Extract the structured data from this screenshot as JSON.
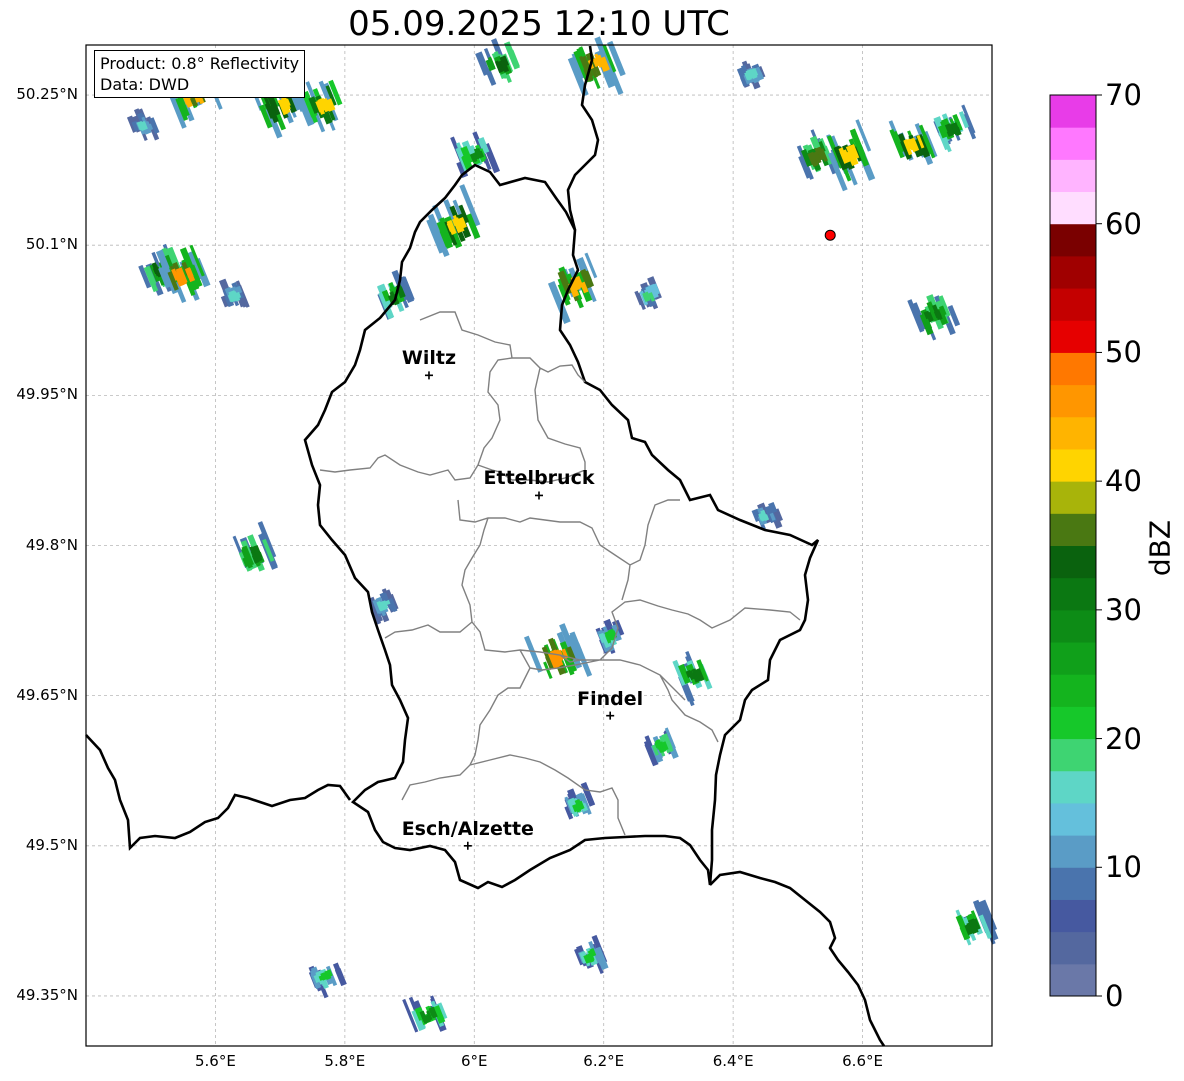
{
  "title": "05.09.2025 12:10 UTC",
  "info_box": {
    "product": "Product: 0.8° Reflectivity",
    "data": "Data: DWD"
  },
  "axes": {
    "lat_ticks": [
      "50.25°N",
      "50.1°N",
      "49.95°N",
      "49.8°N",
      "49.65°N",
      "49.5°N",
      "49.35°N"
    ],
    "lon_ticks": [
      "5.6°E",
      "5.8°E",
      "6°E",
      "6.2°E",
      "6.4°E",
      "6.6°E"
    ],
    "grid": true
  },
  "cities": [
    {
      "name": "Wiltz",
      "lon": 5.93,
      "lat": 49.97
    },
    {
      "name": "Ettelbruck",
      "lon": 6.1,
      "lat": 49.85
    },
    {
      "name": "Findel",
      "lon": 6.21,
      "lat": 49.63
    },
    {
      "name": "Esch/Alzette",
      "lon": 5.99,
      "lat": 49.5
    }
  ],
  "radar_site": {
    "lon": 6.55,
    "lat": 50.11,
    "color": "#ff0000"
  },
  "colorbar": {
    "label": "dBZ",
    "min": 0,
    "max": 70,
    "ticks": [
      "0",
      "10",
      "20",
      "30",
      "40",
      "50",
      "60",
      "70"
    ],
    "colors": [
      "#6a78a8",
      "#54689f",
      "#4659a0",
      "#4a74ad",
      "#5a9cc6",
      "#64c0dc",
      "#5ed6c6",
      "#3ed472",
      "#16c82a",
      "#14b41e",
      "#10a01a",
      "#0d8c16",
      "#0b7812",
      "#0a620e",
      "#4a7812",
      "#a8b40a",
      "#ffd400",
      "#ffb400",
      "#ff9600",
      "#ff7800",
      "#e60000",
      "#c40000",
      "#a00000",
      "#7a0000",
      "#ffddff",
      "#ffb4ff",
      "#ff78ff",
      "#e83ce8"
    ]
  },
  "reflectivity_cells": [
    {
      "lon": 5.565,
      "lat": 50.25,
      "dbz": 44
    },
    {
      "lon": 5.7,
      "lat": 50.24,
      "dbz": 42
    },
    {
      "lon": 5.77,
      "lat": 50.24,
      "dbz": 40
    },
    {
      "lon": 5.49,
      "lat": 50.22,
      "dbz": 15
    },
    {
      "lon": 5.52,
      "lat": 50.075,
      "dbz": 34
    },
    {
      "lon": 5.55,
      "lat": 50.07,
      "dbz": 45
    },
    {
      "lon": 5.63,
      "lat": 50.05,
      "dbz": 15
    },
    {
      "lon": 5.88,
      "lat": 50.05,
      "dbz": 30
    },
    {
      "lon": 5.97,
      "lat": 50.12,
      "dbz": 42
    },
    {
      "lon": 6.0,
      "lat": 50.19,
      "dbz": 28
    },
    {
      "lon": 6.04,
      "lat": 50.28,
      "dbz": 34
    },
    {
      "lon": 6.19,
      "lat": 50.28,
      "dbz": 44
    },
    {
      "lon": 6.16,
      "lat": 50.06,
      "dbz": 44
    },
    {
      "lon": 6.27,
      "lat": 50.05,
      "dbz": 18
    },
    {
      "lon": 6.43,
      "lat": 50.27,
      "dbz": 15
    },
    {
      "lon": 6.53,
      "lat": 50.19,
      "dbz": 35
    },
    {
      "lon": 6.58,
      "lat": 50.19,
      "dbz": 42
    },
    {
      "lon": 6.68,
      "lat": 50.2,
      "dbz": 42
    },
    {
      "lon": 6.74,
      "lat": 50.215,
      "dbz": 30
    },
    {
      "lon": 6.71,
      "lat": 50.03,
      "dbz": 32
    },
    {
      "lon": 5.66,
      "lat": 49.79,
      "dbz": 32
    },
    {
      "lon": 5.86,
      "lat": 49.74,
      "dbz": 15
    },
    {
      "lon": 6.13,
      "lat": 49.69,
      "dbz": 45
    },
    {
      "lon": 6.21,
      "lat": 49.71,
      "dbz": 20
    },
    {
      "lon": 6.34,
      "lat": 49.67,
      "dbz": 30
    },
    {
      "lon": 6.29,
      "lat": 49.6,
      "dbz": 22
    },
    {
      "lon": 6.16,
      "lat": 49.54,
      "dbz": 20
    },
    {
      "lon": 6.18,
      "lat": 49.39,
      "dbz": 20
    },
    {
      "lon": 5.77,
      "lat": 49.37,
      "dbz": 20
    },
    {
      "lon": 5.93,
      "lat": 49.33,
      "dbz": 28
    },
    {
      "lon": 6.77,
      "lat": 49.42,
      "dbz": 30
    },
    {
      "lon": 6.45,
      "lat": 49.83,
      "dbz": 15
    }
  ]
}
